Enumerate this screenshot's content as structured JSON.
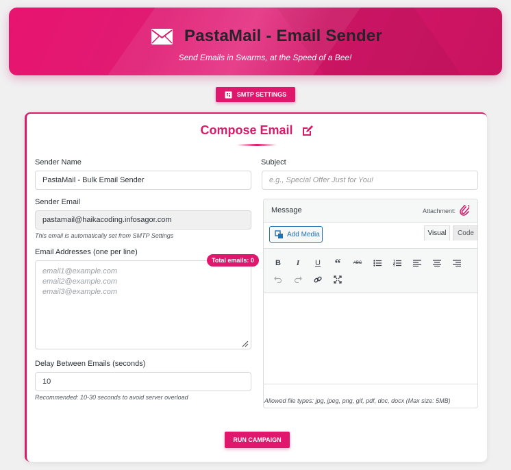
{
  "header": {
    "title": "PastaMail - Email Sender",
    "subtitle": "Send Emails in Swarms, at the Speed of a Bee!",
    "icon": "envelope-icon"
  },
  "toolbar": {
    "smtp_label": "SMTP SETTINGS"
  },
  "compose": {
    "title": "Compose Email",
    "sender_name": {
      "label": "Sender Name",
      "value": "PastaMail - Bulk Email Sender"
    },
    "sender_email": {
      "label": "Sender Email",
      "value": "pastamail@haikacoding.infosagor.com",
      "hint": "This email is automatically set from SMTP Settings"
    },
    "addresses": {
      "label": "Email Addresses (one per line)",
      "placeholder": "email1@example.com\nemail2@example.com\nemail3@example.com",
      "count_badge": "Total emails: 0"
    },
    "delay": {
      "label": "Delay Between Emails (seconds)",
      "value": "10",
      "hint": "Recommended: 10-30 seconds to avoid server overload"
    },
    "subject": {
      "label": "Subject",
      "placeholder": "e.g., Special Offer Just for You!"
    },
    "message": {
      "label": "Message",
      "attachment_label": "Attachment:",
      "add_media": "Add Media",
      "tab_visual": "Visual",
      "tab_code": "Code",
      "allowed_types": "Allowed file types: jpg, jpeg, png, gif, pdf, doc, docx (Max size: 5MB)",
      "tools": [
        "B",
        "I",
        "U",
        "“",
        "ABC",
        "bullet-list",
        "numbered-list",
        "align-left",
        "align-center",
        "align-right",
        "undo",
        "redo",
        "link",
        "fullscreen"
      ]
    },
    "run_label": "RUN CAMPAIGN"
  },
  "colors": {
    "brand": "#e0186d",
    "link": "#2271b1"
  }
}
